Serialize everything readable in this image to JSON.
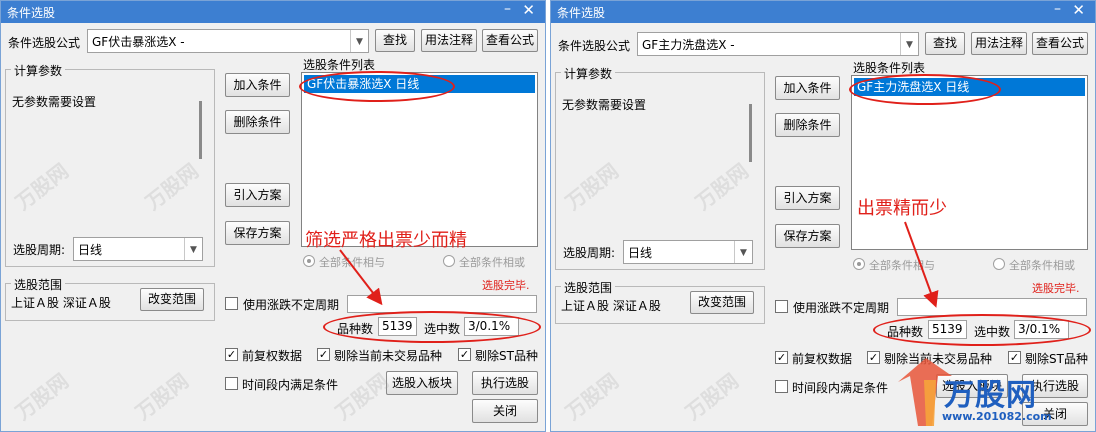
{
  "left": {
    "title": "条件选股",
    "formula_label": "条件选股公式",
    "formula_value": "GF伏击暴涨选X  -",
    "find_button": "查找",
    "usage_button": "用法注释",
    "view_button": "查看公式",
    "calc_params_label": "计算参数",
    "no_params_text": "无参数需要设置",
    "add_condition": "加入条件",
    "delete_condition": "删除条件",
    "import_plan": "引入方案",
    "save_plan": "保存方案",
    "condition_list_label": "选股条件列表",
    "condition_item": "GF伏击暴涨选X  日线",
    "period_label": "选股周期:",
    "period_value": "日线",
    "radio_and": "全部条件相与",
    "radio_or": "全部条件相或",
    "annotation": "筛选严格出票少而精",
    "status_done": "选股完毕.",
    "range_label": "选股范围",
    "range_value": "上证Ａ股 深证Ａ股",
    "change_range": "改变范围",
    "use_uncertain_period": "使用涨跌不定周期",
    "variety_count_label": "品种数",
    "variety_count": "5139",
    "selected_label": "选中数",
    "selected_value": "3/0.1%",
    "pre_adjusted": "前复权数据",
    "exclude_untraded": "剔除当前未交易品种",
    "exclude_st": "剔除ST品种",
    "time_period_condition": "时间段内满足条件",
    "select_to_block": "选股入板块",
    "execute_select": "执行选股",
    "close": "关闭"
  },
  "right": {
    "title": "条件选股",
    "formula_label": "条件选股公式",
    "formula_value": "GF主力洗盘选X  -",
    "find_button": "查找",
    "usage_button": "用法注释",
    "view_button": "查看公式",
    "calc_params_label": "计算参数",
    "no_params_text": "无参数需要设置",
    "add_condition": "加入条件",
    "delete_condition": "删除条件",
    "import_plan": "引入方案",
    "save_plan": "保存方案",
    "condition_list_label": "选股条件列表",
    "condition_item": "GF主力洗盘选X  日线",
    "period_label": "选股周期:",
    "period_value": "日线",
    "radio_and": "全部条件相与",
    "radio_or": "全部条件相或",
    "annotation": "出票精而少",
    "status_done": "选股完毕.",
    "range_label": "选股范围",
    "range_value": "上证Ａ股 深证Ａ股",
    "change_range": "改变范围",
    "use_uncertain_period": "使用涨跌不定周期",
    "variety_count_label": "品种数",
    "variety_count": "5139",
    "selected_label": "选中数",
    "selected_value": "3/0.1%",
    "pre_adjusted": "前复权数据",
    "exclude_untraded": "剔除当前未交易品种",
    "exclude_st": "剔除ST品种",
    "time_period_condition": "时间段内满足条件",
    "select_to_block": "选股入板块",
    "execute_select": "执行选股",
    "close": "关闭"
  },
  "watermark": {
    "text": "万股网",
    "logo_url": "www.201082.com"
  },
  "colors": {
    "titlebar": "#3d7fd1",
    "selection": "#0078d7",
    "annotation_red": "#e0201a",
    "status_red": "#e0201a"
  },
  "icons": {
    "close": "close-icon",
    "minimize": "minimize-icon",
    "dropdown": "chevron-down-icon",
    "checkbox_checked": "check-icon"
  }
}
